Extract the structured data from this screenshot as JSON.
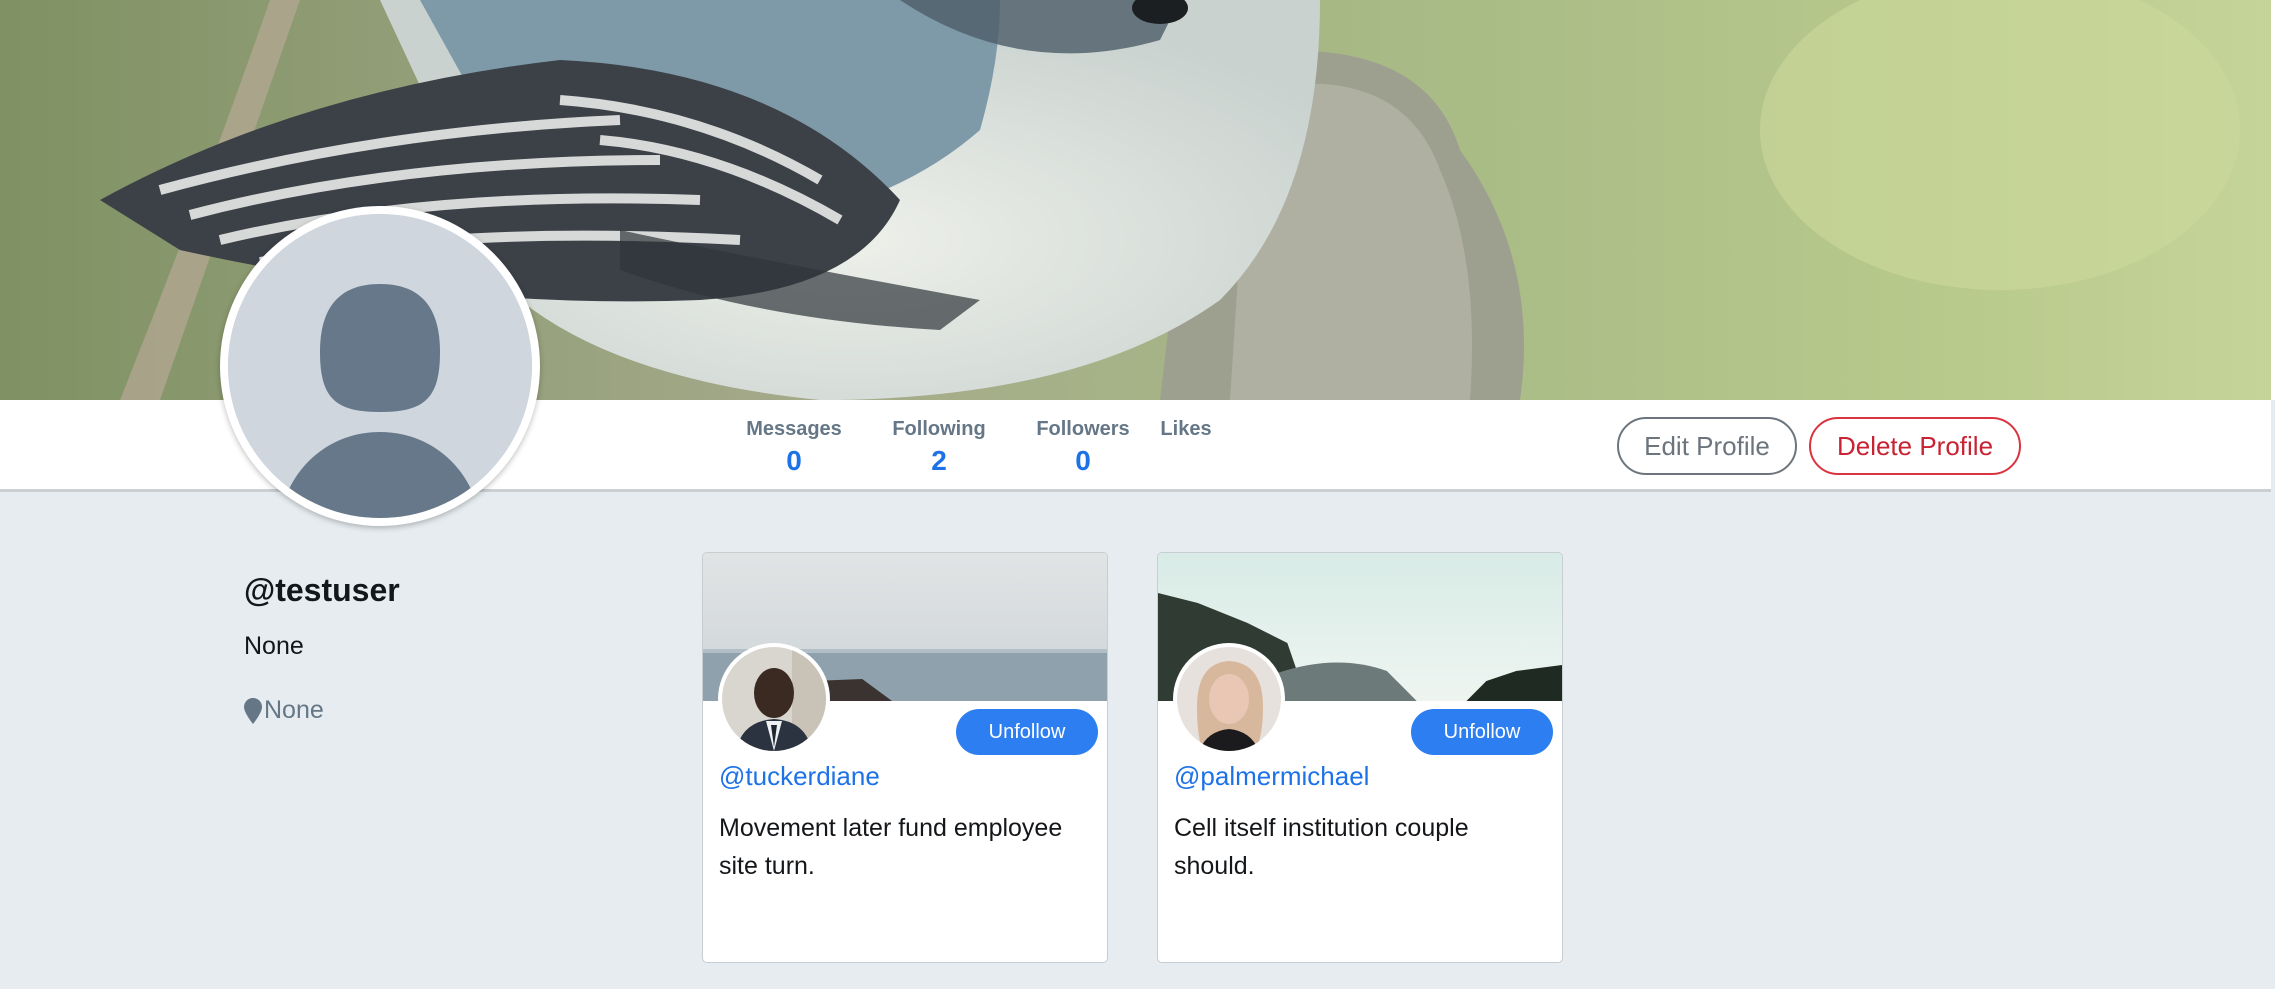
{
  "profile": {
    "username": "@testuser",
    "bio": "None",
    "location": "None"
  },
  "stats": [
    {
      "label": "Messages",
      "value": "0"
    },
    {
      "label": "Following",
      "value": "2"
    },
    {
      "label": "Followers",
      "value": "0"
    },
    {
      "label": "Likes",
      "value": ""
    }
  ],
  "actions": {
    "edit_label": "Edit Profile",
    "delete_label": "Delete Profile"
  },
  "following": [
    {
      "handle": "@tuckerdiane",
      "text": "Movement later fund employee site turn.",
      "button": "Unfollow"
    },
    {
      "handle": "@palmermichael",
      "text": "Cell itself institution couple should.",
      "button": "Unfollow"
    }
  ],
  "colors": {
    "accent": "#1d72e8",
    "button_blue": "#2d7ef0",
    "danger": "#c82333",
    "muted": "#657786",
    "background": "#e6ecf0"
  },
  "icons": {
    "location": "map-pin-icon",
    "avatar": "default-user-icon"
  }
}
